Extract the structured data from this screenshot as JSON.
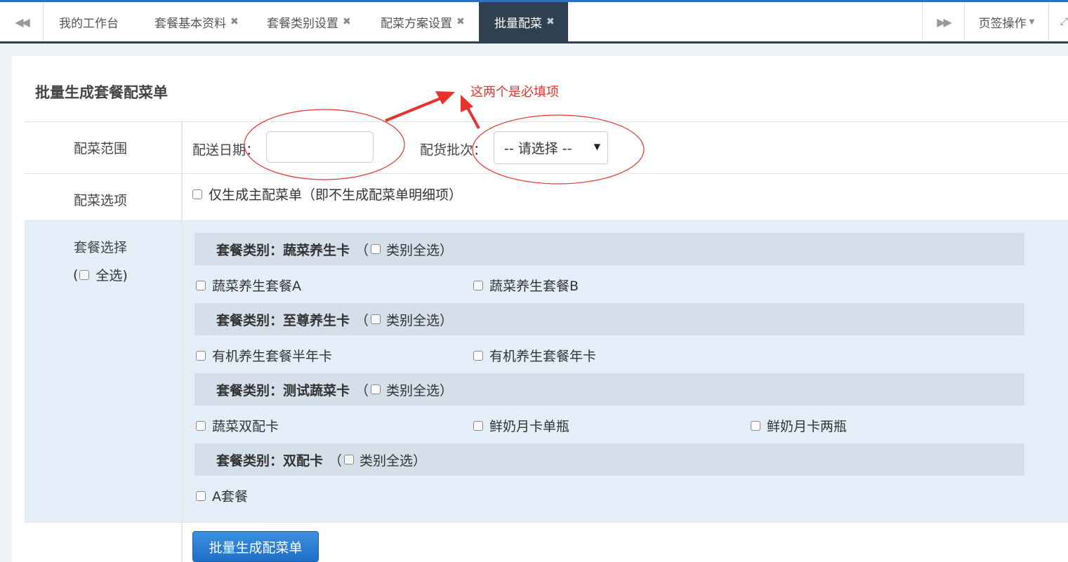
{
  "tabs": {
    "items": [
      {
        "label": "我的工作台",
        "closable": false,
        "active": false
      },
      {
        "label": "套餐基本资料",
        "closable": true,
        "active": false
      },
      {
        "label": "套餐类别设置",
        "closable": true,
        "active": false
      },
      {
        "label": "配菜方案设置",
        "closable": true,
        "active": false
      },
      {
        "label": "批量配菜",
        "closable": true,
        "active": true
      }
    ],
    "close_glyph": "✖",
    "page_ops_label": "页签操作",
    "nav_left_icon": "double-chevron-left-icon",
    "nav_right_icon": "double-chevron-right-icon"
  },
  "page": {
    "title": "批量生成套餐配菜单"
  },
  "form": {
    "range_label": "配菜范围",
    "date_label": "配送日期：",
    "date_value": "",
    "batch_label": "配货批次：",
    "batch_selected": "-- 请选择 --",
    "options_label": "配菜选项",
    "only_main_label": "仅生成主配菜单（即不生成配菜单明细项）",
    "package_select_label": "套餐选择",
    "select_all_open": "(",
    "select_all_label": "全选)",
    "categories": [
      {
        "prefix": "套餐类别：",
        "name": "蔬菜养生卡",
        "select_all": "类别全选）",
        "items": [
          "蔬菜养生套餐A",
          "蔬菜养生套餐B"
        ]
      },
      {
        "prefix": "套餐类别：",
        "name": "至尊养生卡",
        "select_all": "类别全选）",
        "items": [
          "有机养生套餐半年卡",
          "有机养生套餐年卡"
        ]
      },
      {
        "prefix": "套餐类别：",
        "name": "测试蔬菜卡",
        "select_all": "类别全选）",
        "items": [
          "蔬菜双配卡",
          "鲜奶月卡单瓶",
          "鲜奶月卡两瓶"
        ]
      },
      {
        "prefix": "套餐类别：",
        "name": "双配卡",
        "select_all": "类别全选）",
        "items": [
          "A套餐"
        ]
      }
    ],
    "submit_label": "批量生成配菜单"
  },
  "annotation": {
    "text": "这两个是必填项",
    "color": "#e8322d"
  },
  "colors": {
    "active_tab": "#2f4050",
    "row_highlight": "#e3eef9",
    "category_bar": "#d4dfea",
    "primary_button": "#1f6fc6"
  }
}
